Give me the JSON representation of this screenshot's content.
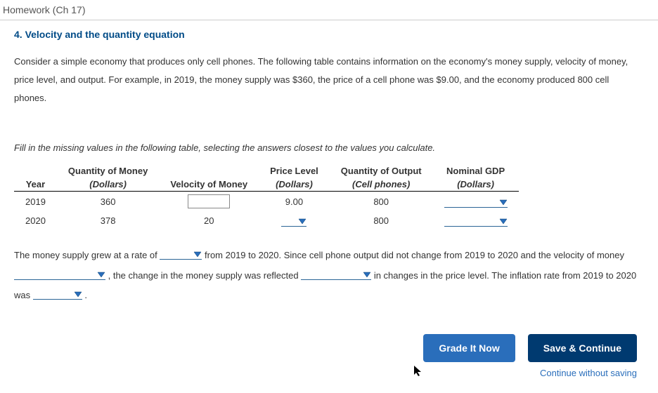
{
  "header": {
    "title": "Homework (Ch 17)"
  },
  "question": {
    "title": "4. Velocity and the quantity equation",
    "intro": "Consider a simple economy that produces only cell phones. The following table contains information on the economy's money supply, velocity of money, price level, and output. For example, in 2019, the money supply was $360, the price of a cell phone was $9.00, and the economy produced 800 cell phones.",
    "instruction": "Fill in the missing values in the following table, selecting the answers closest to the values you calculate."
  },
  "table": {
    "headers": {
      "year": "Year",
      "qty_money": "Quantity of Money",
      "qty_money_sub": "(Dollars)",
      "velocity": "Velocity of Money",
      "price": "Price Level",
      "price_sub": "(Dollars)",
      "output": "Quantity of Output",
      "output_sub": "(Cell phones)",
      "gdp": "Nominal GDP",
      "gdp_sub": "(Dollars)"
    },
    "rows": [
      {
        "year": "2019",
        "qty_money": "360",
        "velocity": "",
        "price": "9.00",
        "output": "800",
        "gdp": ""
      },
      {
        "year": "2020",
        "qty_money": "378",
        "velocity": "20",
        "price": "",
        "output": "800",
        "gdp": ""
      }
    ]
  },
  "fill": {
    "t1": "The money supply grew at a rate of ",
    "t2": " from 2019 to 2020. Since cell phone output did not change from 2019 to 2020 and the velocity of money ",
    "t3": " , the change in the money supply was reflected ",
    "t4": " in changes in the price level. The inflation rate from 2019 to 2020 was ",
    "t5": " ."
  },
  "buttons": {
    "grade": "Grade It Now",
    "save": "Save & Continue",
    "continue": "Continue without saving"
  }
}
